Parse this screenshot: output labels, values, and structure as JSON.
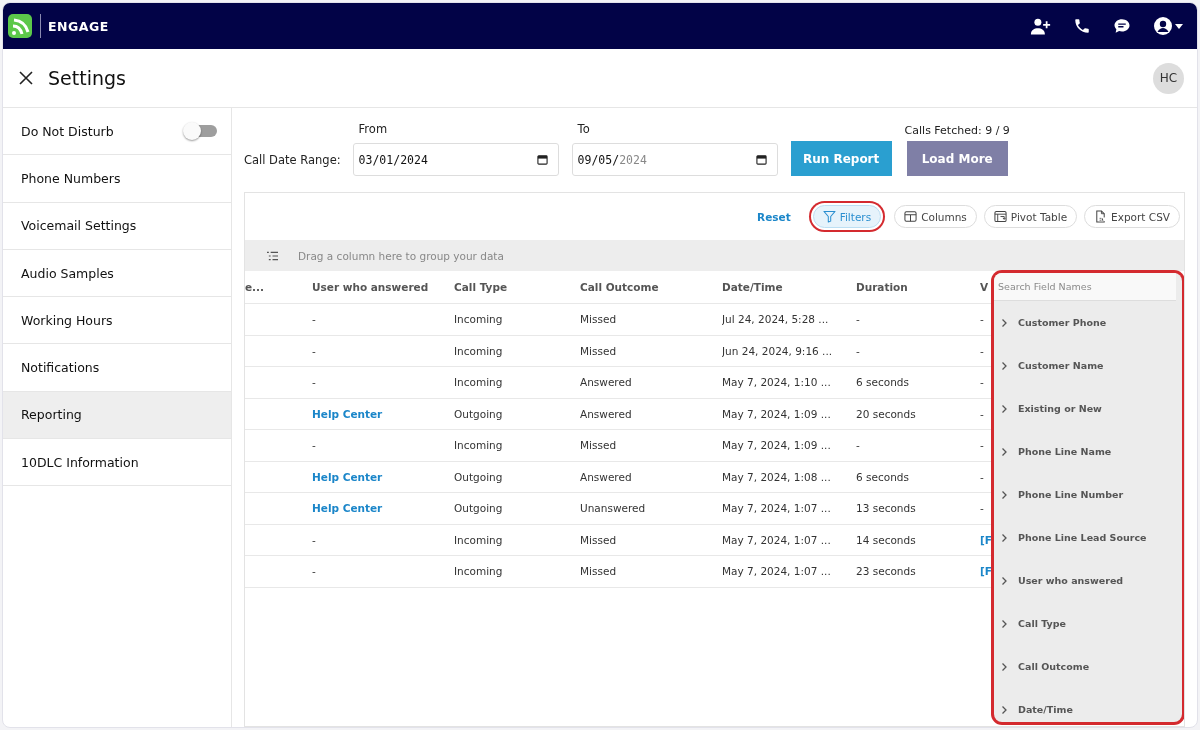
{
  "app": {
    "name": "ENGAGE"
  },
  "page": {
    "title": "Settings",
    "avatar": "HC"
  },
  "sidebar": {
    "items": [
      {
        "label": "Do Not Disturb",
        "kind": "toggle",
        "on": false,
        "selected": false
      },
      {
        "label": "Phone Numbers",
        "kind": "link",
        "selected": false
      },
      {
        "label": "Voicemail Settings",
        "kind": "link",
        "selected": false
      },
      {
        "label": "Audio Samples",
        "kind": "link",
        "selected": false
      },
      {
        "label": "Working Hours",
        "kind": "link",
        "selected": false
      },
      {
        "label": "Notifications",
        "kind": "link",
        "selected": false
      },
      {
        "label": "Reporting",
        "kind": "link",
        "selected": true
      },
      {
        "label": "10DLC Information",
        "kind": "link",
        "selected": false
      }
    ]
  },
  "report": {
    "range_label": "Call Date Range:",
    "from": {
      "label": "From",
      "value": "03/01/2024"
    },
    "to": {
      "label": "To",
      "value": "09/05/",
      "hint": "2024"
    },
    "run_button": "Run Report",
    "load_more_button": "Load More",
    "fetched": "Calls Fetched: 9 / 9"
  },
  "grid": {
    "toolbar": [
      {
        "label": "Reset",
        "kind": "link",
        "selected": false
      },
      {
        "label": "Filters",
        "kind": "filter",
        "selected": true
      },
      {
        "label": "Columns",
        "kind": "columns",
        "selected": false
      },
      {
        "label": "Pivot Table",
        "kind": "pivot",
        "selected": false
      },
      {
        "label": "Export CSV",
        "kind": "export",
        "selected": false
      }
    ],
    "group_hint": "Drag a column here to group your data",
    "columns": [
      "e...",
      "User who answered",
      "Call Type",
      "Call Outcome",
      "Date/Time",
      "Duration",
      "V"
    ],
    "rows": [
      {
        "cells": [
          "",
          "-",
          "Incoming",
          "Missed",
          "Jul 24, 2024, 5:28 ...",
          "-",
          "-"
        ],
        "user_link": false,
        "column_7_link": false
      },
      {
        "cells": [
          "",
          "-",
          "Incoming",
          "Missed",
          "Jun 24, 2024, 9:16 ...",
          "-",
          "-"
        ],
        "user_link": false,
        "column_7_link": false
      },
      {
        "cells": [
          "",
          "-",
          "Incoming",
          "Answered",
          "May 7, 2024, 1:10 ...",
          "6 seconds",
          "-"
        ],
        "user_link": false,
        "column_7_link": false
      },
      {
        "cells": [
          "",
          "Help Center",
          "Outgoing",
          "Answered",
          "May 7, 2024, 1:09 ...",
          "20 seconds",
          "-"
        ],
        "user_link": true,
        "column_7_link": false
      },
      {
        "cells": [
          "",
          "-",
          "Incoming",
          "Missed",
          "May 7, 2024, 1:09 ...",
          "-",
          "-"
        ],
        "user_link": false,
        "column_7_link": false
      },
      {
        "cells": [
          "",
          "Help Center",
          "Outgoing",
          "Answered",
          "May 7, 2024, 1:08 ...",
          "6 seconds",
          "-"
        ],
        "user_link": true,
        "column_7_link": false
      },
      {
        "cells": [
          "",
          "Help Center",
          "Outgoing",
          "Unanswered",
          "May 7, 2024, 1:07 ...",
          "13 seconds",
          "-"
        ],
        "user_link": true,
        "column_7_link": false
      },
      {
        "cells": [
          "",
          "-",
          "Incoming",
          "Missed",
          "May 7, 2024, 1:07 ...",
          "14 seconds",
          "[F"
        ],
        "user_link": false,
        "column_7_link": true
      },
      {
        "cells": [
          "",
          "-",
          "Incoming",
          "Missed",
          "May 7, 2024, 1:07 ...",
          "23 seconds",
          "[F"
        ],
        "user_link": false,
        "column_7_link": true
      }
    ],
    "field_panel": {
      "highlighted": true,
      "search_placeholder": "Search Field Names",
      "fields": [
        {
          "label": "Customer Phone",
          "expanded": false
        },
        {
          "label": "Customer Name",
          "expanded": false
        },
        {
          "label": "Existing or New",
          "expanded": false
        },
        {
          "label": "Phone Line Name",
          "expanded": false
        },
        {
          "label": "Phone Line Number",
          "expanded": false
        },
        {
          "label": "Phone Line Lead Source",
          "expanded": false
        },
        {
          "label": "User who answered",
          "expanded": false
        },
        {
          "label": "Call Type",
          "expanded": false
        },
        {
          "label": "Call Outcome",
          "expanded": false
        },
        {
          "label": "Date/Time",
          "expanded": false
        }
      ]
    }
  }
}
